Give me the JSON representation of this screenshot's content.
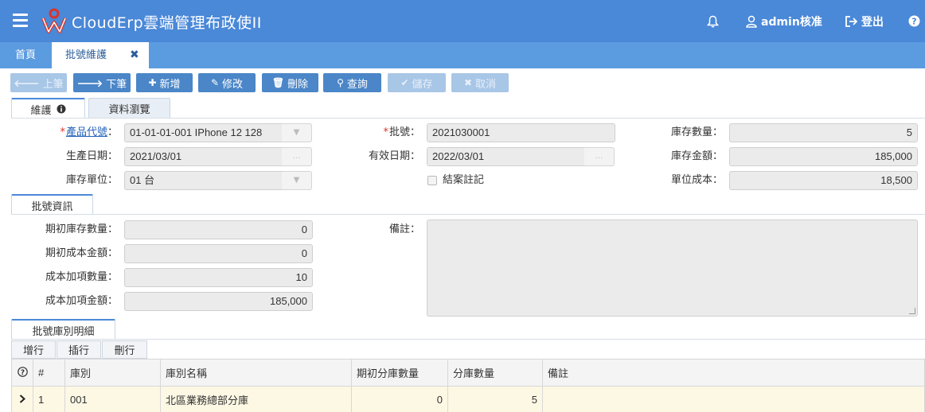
{
  "header": {
    "app_title": "CloudErp雲端管理布政使II",
    "user_name": "admin核准",
    "logout_label": "登出",
    "brand_color": "#4a88d8"
  },
  "page_tabs": {
    "home": "首頁",
    "active": "批號維護",
    "close_icon": "✖"
  },
  "toolbar": {
    "prev": "上筆",
    "next": "下筆",
    "add": "新增",
    "edit": "修改",
    "delete": "刪除",
    "query": "查詢",
    "save": "儲存",
    "cancel": "取消"
  },
  "form_tabs": {
    "maintain": "維護",
    "browse": "資料瀏覽"
  },
  "form": {
    "product_code_label": "產品代號",
    "product_code_value": "01-01-01-001 IPhone 12 128",
    "batch_no_label": "批號：",
    "batch_no_value": "2021030001",
    "stock_qty_label": "庫存數量：",
    "stock_qty_value": "5",
    "production_date_label": "生產日期：",
    "production_date_value": "2021/03/01",
    "expiry_date_label": "有效日期：",
    "expiry_date_value": "2022/03/01",
    "stock_amount_label": "庫存金額：",
    "stock_amount_value": "185,000",
    "stock_unit_label": "庫存單位：",
    "stock_unit_value": "01 台",
    "closed_label": "結案註記",
    "unit_cost_label": "單位成本：",
    "unit_cost_value": "18,500",
    "dropdown_glyph": "▼",
    "ellipsis_glyph": "..."
  },
  "batch_info": {
    "tab": "批號資訊",
    "opening_qty_label": "期初庫存數量：",
    "opening_qty_value": "0",
    "opening_cost_label": "期初成本金額：",
    "opening_cost_value": "0",
    "added_qty_label": "成本加項數量：",
    "added_qty_value": "10",
    "added_amount_label": "成本加項金額：",
    "added_amount_value": "185,000",
    "remark_label": "備註："
  },
  "warehouse_detail": {
    "tab": "批號庫別明細",
    "add_row": "增行",
    "insert_row": "插行",
    "delete_row": "刪行",
    "columns": [
      "#",
      "庫別",
      "庫別名稱",
      "期初分庫數量",
      "分庫數量",
      "備註"
    ],
    "rows": [
      {
        "row_no": "1",
        "warehouse": "001",
        "warehouse_name": "北區業務總部分庫",
        "opening_qty": "0",
        "qty": "5",
        "remark": ""
      }
    ]
  }
}
